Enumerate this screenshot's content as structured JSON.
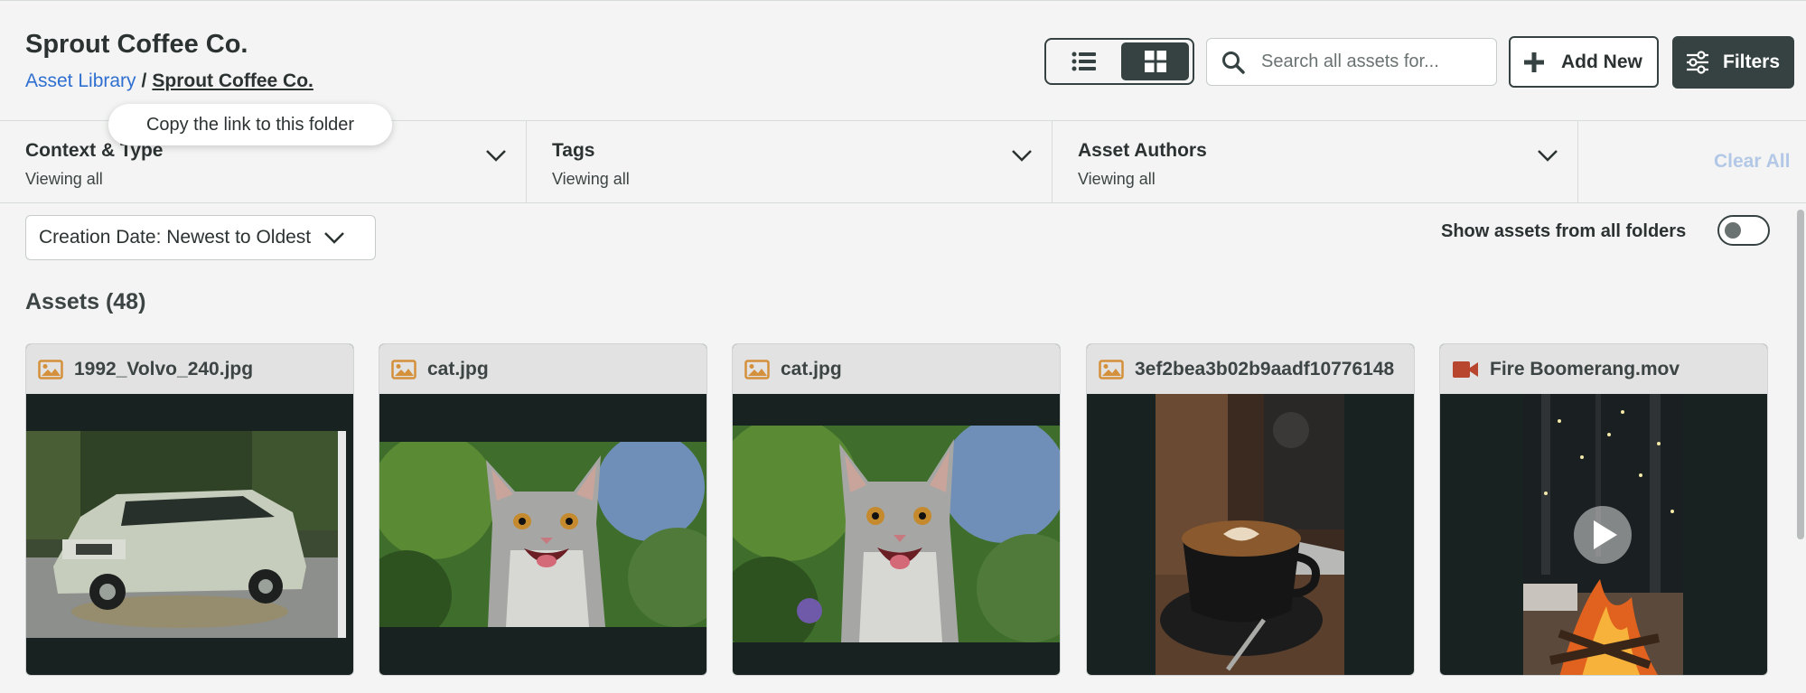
{
  "header": {
    "title": "Sprout Coffee Co.",
    "breadcrumb": {
      "root": "Asset Library",
      "separator": "/",
      "current": "Sprout Coffee Co."
    },
    "search_placeholder": "Search all assets for...",
    "add_new_label": "Add New",
    "filters_label": "Filters"
  },
  "tooltip": "Copy the link to this folder",
  "filter_bar": {
    "segments": [
      {
        "label": "Context & Type",
        "sub": "Viewing all"
      },
      {
        "label": "Tags",
        "sub": "Viewing all"
      },
      {
        "label": "Asset Authors",
        "sub": "Viewing all"
      }
    ],
    "clear_all": "Clear All"
  },
  "controls": {
    "sort_label": "Creation Date: Newest to Oldest",
    "toggle_label": "Show assets from all folders",
    "toggle_on": false
  },
  "assets": {
    "heading": "Assets (48)",
    "items": [
      {
        "name": "1992_Volvo_240.jpg",
        "icon": "image-icon",
        "kind": "image"
      },
      {
        "name": "cat.jpg",
        "icon": "image-icon",
        "kind": "image"
      },
      {
        "name": "cat.jpg",
        "icon": "image-icon",
        "kind": "image"
      },
      {
        "name": "3ef2bea3b02b9aadf10776148",
        "icon": "image-icon",
        "kind": "image"
      },
      {
        "name": "Fire Boomerang.mov",
        "icon": "video-icon",
        "kind": "video"
      }
    ]
  },
  "colors": {
    "accent_dark": "#364141",
    "link": "#2f6fd1",
    "image_icon": "#d4903a",
    "video_icon": "#b8452e",
    "card_bg": "#172221"
  }
}
